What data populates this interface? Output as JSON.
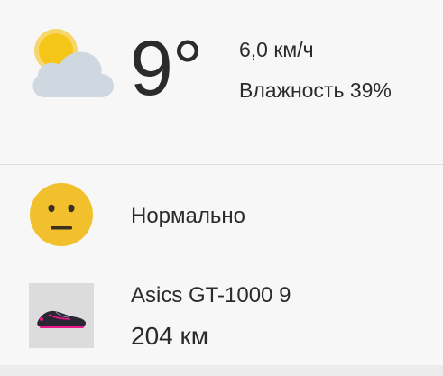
{
  "weather": {
    "icon": "partly-cloudy-icon",
    "temperature": "9°",
    "wind": "6,0 км/ч",
    "humidity": "Влажность 39%"
  },
  "feeling": {
    "icon": "neutral-face-icon",
    "label": "Нормально"
  },
  "shoe": {
    "icon": "running-shoe-icon",
    "name": "Asics GT-1000 9",
    "distance": "204 км"
  },
  "colors": {
    "sun": "#f5c518",
    "cloud": "#cfd8e1",
    "face": "#f2c02d",
    "shoe_accent": "#e8178a"
  }
}
